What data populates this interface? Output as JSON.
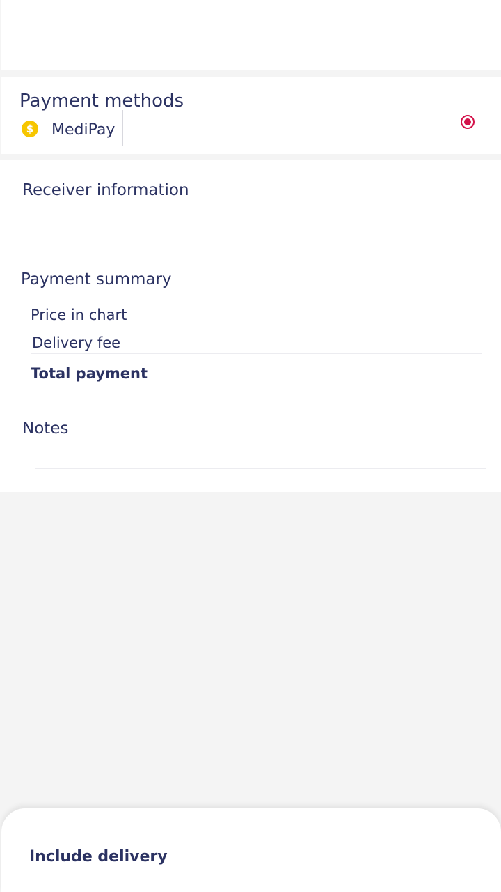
{
  "payment_methods": {
    "title": "Payment methods",
    "selected_method": {
      "label": "MediPay",
      "icon": "dollar-coin-icon",
      "icon_glyph": "$",
      "selected": true
    }
  },
  "receiver": {
    "title": "Receiver information"
  },
  "summary": {
    "title": "Payment summary",
    "price_label": "Price in chart",
    "delivery_label": "Delivery fee",
    "total_label": "Total payment"
  },
  "notes": {
    "title": "Notes"
  },
  "bottom_sheet": {
    "label": "Include delivery"
  },
  "colors": {
    "text": "#2b3262",
    "accent": "#d3124a",
    "coin": "#f7c600",
    "background": "#f4f4f4",
    "card": "#ffffff"
  }
}
